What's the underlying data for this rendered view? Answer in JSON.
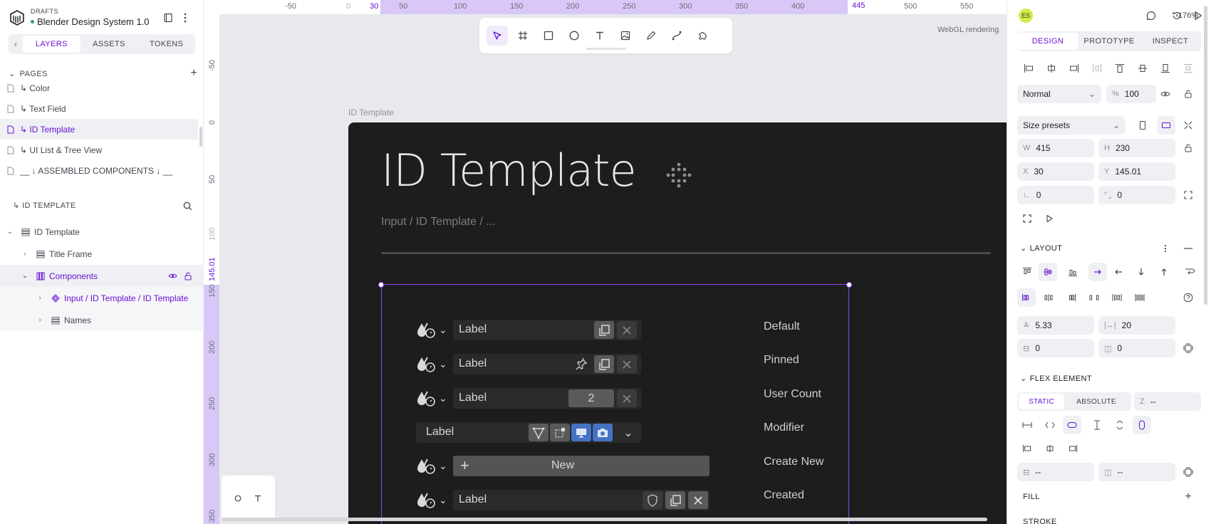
{
  "project": {
    "section": "DRAFTS",
    "name": "Blender Design System 1.0"
  },
  "left_tabs": [
    "LAYERS",
    "ASSETS",
    "TOKENS"
  ],
  "pages": {
    "title": "PAGES",
    "items": [
      "↳ Color",
      "↳ Text Field",
      "↳ ID Template",
      "↳ UI List & Tree View",
      "__ ↓ ASSEMBLED COMPONENTS ↓ __"
    ]
  },
  "layers": {
    "title": "↳ ID TEMPLATE",
    "items": [
      "ID Template",
      "Title Frame",
      "Components",
      "Input / ID Template / ID Template",
      "Names"
    ]
  },
  "ruler": {
    "top": [
      "-50",
      "0",
      "30",
      "50",
      "100",
      "150",
      "200",
      "250",
      "300",
      "350",
      "400",
      "445",
      "500",
      "550"
    ],
    "left": [
      "-50",
      "0",
      "50",
      "100",
      "145.01",
      "150",
      "200",
      "250",
      "300",
      "350"
    ]
  },
  "canvas": {
    "webgl": "WebGL rendering",
    "board_label": "ID Template",
    "title": "ID Template",
    "subtitle": "Input / ID Template / ...",
    "rows": [
      {
        "label": "Label",
        "name": "Default"
      },
      {
        "label": "Label",
        "name": "Pinned"
      },
      {
        "label": "Label",
        "count": "2",
        "name": "User Count"
      },
      {
        "label": "Label",
        "name": "Modifier"
      },
      {
        "new_label": "New",
        "name": "Create New"
      },
      {
        "label": "Label",
        "name": "Created"
      }
    ]
  },
  "right": {
    "avatar": "ES",
    "zoom": "176%",
    "tabs": [
      "DESIGN",
      "PROTOTYPE",
      "INSPECT"
    ],
    "blend_mode": "Normal",
    "opacity_label": "%",
    "opacity": "100",
    "size_presets": "Size presets",
    "w_label": "W",
    "w": "415",
    "h_label": "H",
    "h": "230",
    "x_label": "X",
    "x": "30",
    "y_label": "Y",
    "y": "145.01",
    "rotation": "0",
    "radius": "0",
    "layout_title": "LAYOUT",
    "gap_row": "5.33",
    "gap_col": "20",
    "pad_v": "0",
    "pad_h": "0",
    "flex_title": "FLEX ELEMENT",
    "flex_tabs": [
      "STATIC",
      "ABSOLUTE"
    ],
    "z_label": "Z",
    "z_value": "--",
    "min_w": "--",
    "min_h": "--",
    "fill_title": "FILL",
    "stroke_title": "STROKE"
  },
  "colors": {
    "accent": "#6911d4",
    "board": "#1d1d1d",
    "selection": "#8a4af0"
  }
}
